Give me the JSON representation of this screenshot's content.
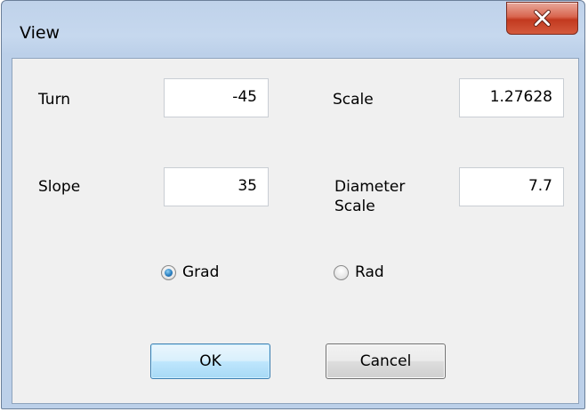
{
  "window": {
    "title": "View",
    "close_glyph": "X"
  },
  "fields": {
    "turn": {
      "label": "Turn",
      "value": "-45"
    },
    "scale": {
      "label": "Scale",
      "value": "1.27628"
    },
    "slope": {
      "label": "Slope",
      "value": "35"
    },
    "diameter_scale": {
      "label_line1": "Diameter",
      "label_line2": "Scale",
      "value": "7.7"
    }
  },
  "angle_unit": {
    "options": [
      {
        "label": "Grad",
        "selected": true
      },
      {
        "label": "Rad",
        "selected": false
      }
    ]
  },
  "buttons": {
    "ok_label": "OK",
    "cancel_label": "Cancel"
  },
  "colors": {
    "titlebar": "#c6d8ee",
    "close_button": "#c2391f",
    "client": "#f0f0f0",
    "ok_button_focus": "#3c7fb1"
  }
}
